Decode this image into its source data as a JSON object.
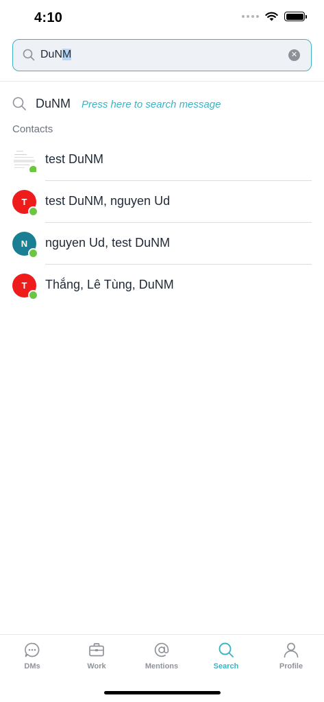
{
  "status_bar": {
    "time": "4:10"
  },
  "search": {
    "query_prefix": "DuN",
    "query_selected": "M"
  },
  "message_search": {
    "query": "DuNM",
    "hint": "Press here to search message"
  },
  "contacts_section": {
    "label": "Contacts",
    "items": [
      {
        "name": "test DuNM",
        "avatar_type": "image",
        "initial": "",
        "avatar_color": "#ffffff",
        "online": true
      },
      {
        "name": "test DuNM, nguyen Ud",
        "avatar_type": "initial",
        "initial": "T",
        "avatar_color": "#ef1c1c",
        "online": true
      },
      {
        "name": "nguyen Ud, test DuNM",
        "avatar_type": "initial",
        "initial": "N",
        "avatar_color": "#1b7f94",
        "online": true
      },
      {
        "name": "Thắng, Lê Tùng, DuNM",
        "avatar_type": "initial",
        "initial": "T",
        "avatar_color": "#ef1c1c",
        "online": true
      }
    ]
  },
  "tab_bar": {
    "active": "Search",
    "accent_color": "#3bb3c3",
    "tabs": [
      {
        "label": "DMs",
        "icon": "chat-bubble-icon"
      },
      {
        "label": "Work",
        "icon": "briefcase-icon"
      },
      {
        "label": "Mentions",
        "icon": "at-sign-icon"
      },
      {
        "label": "Search",
        "icon": "search-icon"
      },
      {
        "label": "Profile",
        "icon": "person-icon"
      }
    ]
  }
}
